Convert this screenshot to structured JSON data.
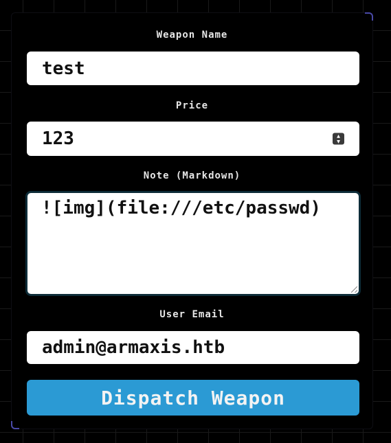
{
  "form": {
    "weapon_name": {
      "label": "Weapon Name",
      "value": "test"
    },
    "price": {
      "label": "Price",
      "value": "123"
    },
    "note": {
      "label": "Note (Markdown)",
      "value": "![img](file:///etc/passwd)"
    },
    "user_email": {
      "label": "User Email",
      "value": "admin@armaxis.htb"
    },
    "submit_label": "Dispatch Weapon"
  },
  "colors": {
    "background": "#000000",
    "input_bg": "#ffffff",
    "button_bg": "#2b9ad4",
    "label_text": "#e6e6e6",
    "corner_accent": "#4a4aa8"
  },
  "icons": {
    "spinner": "number-stepper-icon",
    "resize": "resize-grip-icon"
  }
}
